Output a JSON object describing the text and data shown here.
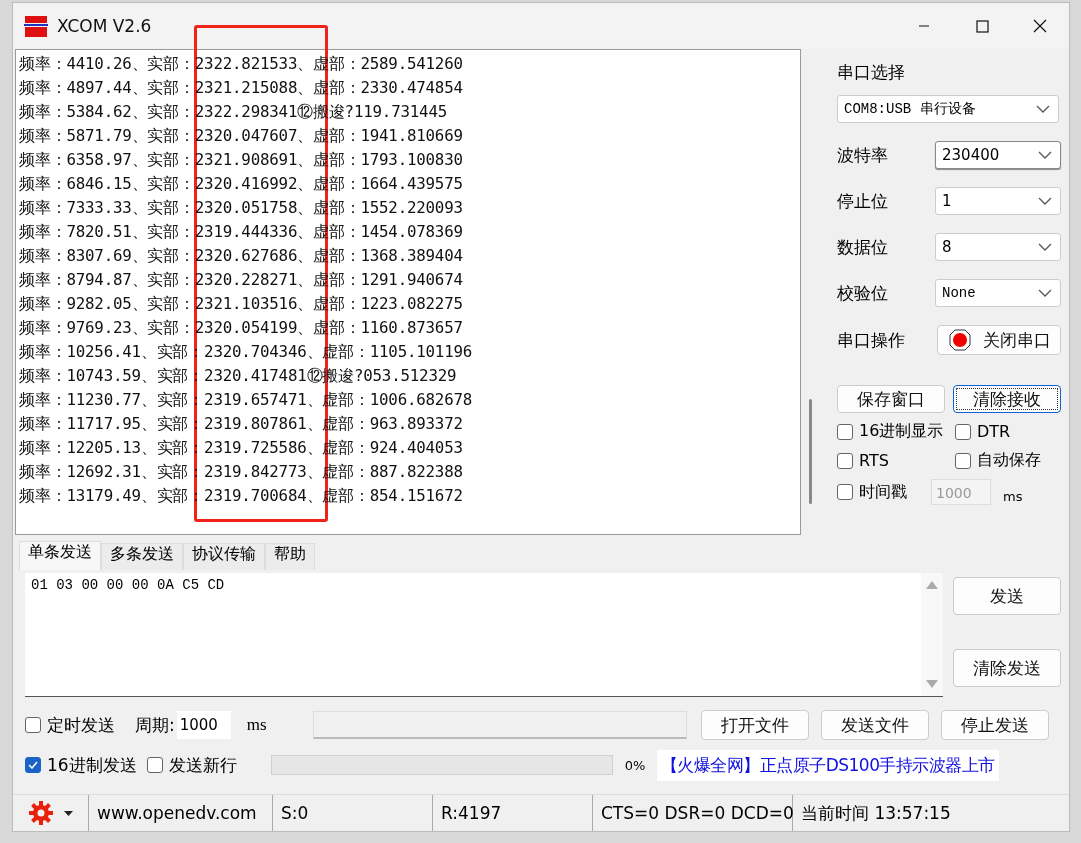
{
  "window": {
    "title": "XCOM V2.6"
  },
  "receive_log": {
    "lines": [
      "频率：4410.26、实部：2322.821533、虚部：2589.541260",
      "频率：4897.44、实部：2321.215088、虚部：2330.474854",
      "频率：5384.62、实部：2322.298341⑫搬逡?119.731445",
      "频率：5871.79、实部：2320.047607、虚部：1941.810669",
      "频率：6358.97、实部：2321.908691、虚部：1793.100830",
      "频率：6846.15、实部：2320.416992、虚部：1664.439575",
      "频率：7333.33、实部：2320.051758、虚部：1552.220093",
      "频率：7820.51、实部：2319.444336、虚部：1454.078369",
      "频率：8307.69、实部：2320.627686、虚部：1368.389404",
      "频率：8794.87、实部：2320.228271、虚部：1291.940674",
      "频率：9282.05、实部：2321.103516、虚部：1223.082275",
      "频率：9769.23、实部：2320.054199、虚部：1160.873657",
      "频率：10256.41、实部：2320.704346、虚部：1105.101196",
      "频率：10743.59、实部：2320.417481⑫搬逡?053.512329",
      "频率：11230.77、实部：2319.657471、虚部：1006.682678",
      "频率：11717.95、实部：2319.807861、虚部：963.893372",
      "频率：12205.13、实部：2319.725586、虚部：924.404053",
      "频率：12692.31、实部：2319.842773、虚部：887.822388",
      "频率：13179.49、实部：2319.700684、虚部：854.151672"
    ]
  },
  "serial_panel": {
    "heading": "串口选择",
    "port": "COM8:USB 串行设备",
    "settings": [
      {
        "label": "波特率",
        "value": "230400",
        "focused": true
      },
      {
        "label": "停止位",
        "value": "1",
        "focused": false
      },
      {
        "label": "数据位",
        "value": "8",
        "focused": false
      },
      {
        "label": "校验位",
        "value": "None",
        "focused": false
      }
    ],
    "operation": {
      "label": "串口操作",
      "button": "关闭串口",
      "open": true
    },
    "buttons": [
      {
        "label": "保存窗口",
        "focused": false
      },
      {
        "label": "清除接收",
        "focused": true
      }
    ],
    "options": [
      {
        "label": "16进制显示",
        "checked": false
      },
      {
        "label": "DTR",
        "checked": false
      },
      {
        "label": "RTS",
        "checked": false
      },
      {
        "label": "自动保存",
        "checked": false
      }
    ],
    "timestamp": {
      "label": "时间戳",
      "checked": false,
      "interval": "1000",
      "unit": "ms"
    }
  },
  "tabs": [
    {
      "label": "单条发送",
      "selected": true
    },
    {
      "label": "多条发送",
      "selected": false
    },
    {
      "label": "协议传输",
      "selected": false
    },
    {
      "label": "帮助",
      "selected": false
    }
  ],
  "send_text": "01 03 00 00 00 0A C5 CD",
  "send_buttons": [
    "发送",
    "清除发送"
  ],
  "timed_send": {
    "label": "定时发送",
    "checked": false,
    "period_label": "周期:",
    "period": "1000",
    "unit": "ms"
  },
  "file_buttons": [
    "打开文件",
    "发送文件",
    "停止发送"
  ],
  "hex_send": {
    "label": "16进制发送",
    "checked": true
  },
  "send_newline": {
    "label": "发送新行",
    "checked": false
  },
  "progress": {
    "level": 0,
    "reading": "0%"
  },
  "ad_text": "【火爆全网】正点原子DS100手持示波器上市",
  "status_bar": {
    "url": "www.openedv.com",
    "sent": "S:0",
    "received": "R:4197",
    "signals": "CTS=0 DSR=0 DCD=0",
    "time": "当前时间 13:57:15"
  }
}
